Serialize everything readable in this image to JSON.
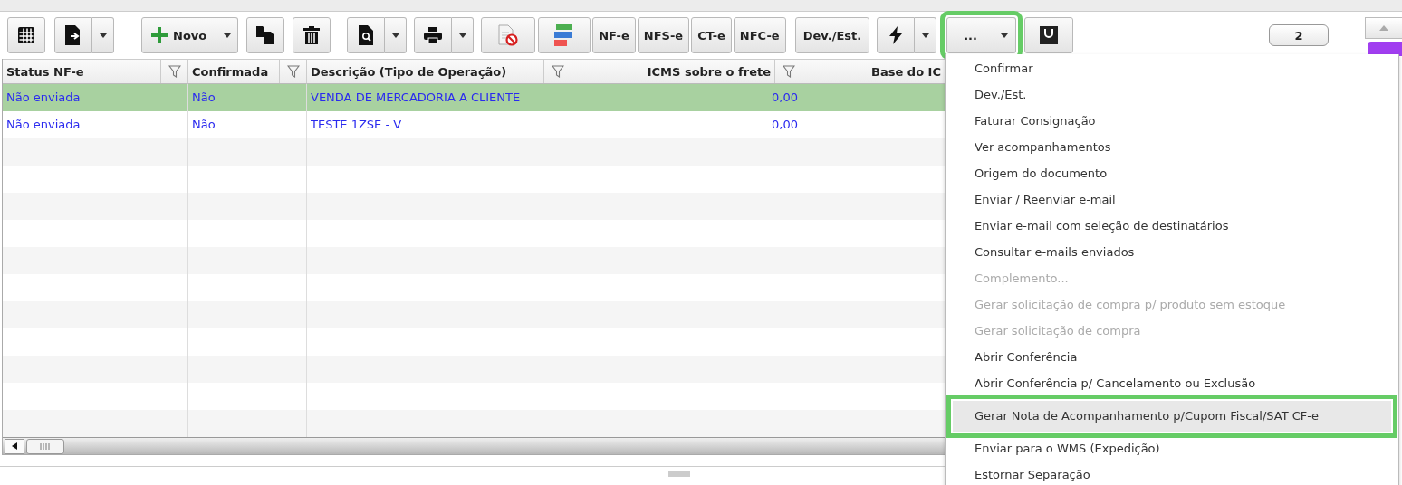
{
  "toolbar": {
    "new_button": {
      "label": "Novo"
    },
    "document_buttons": [
      "NF-e",
      "NFS-e",
      "CT-e",
      "NFC-e"
    ],
    "return_button": {
      "label": "Dev./Est."
    },
    "more_button": {
      "label": "...",
      "highlighted": true
    },
    "counter": "2"
  },
  "table": {
    "columns": [
      {
        "label": "Status NF-e",
        "filter": true
      },
      {
        "label": "Confirmada",
        "filter": true
      },
      {
        "label": "Descrição (Tipo de Operação)",
        "filter": true
      },
      {
        "label": "ICMS sobre o frete",
        "filter": true
      },
      {
        "label": "Base do IC",
        "filter": false
      }
    ],
    "rows": [
      {
        "selected": true,
        "cells": [
          "Não enviada",
          "Não",
          "VENDA DE MERCADORIA A CLIENTE",
          "0,00"
        ]
      },
      {
        "selected": false,
        "cells": [
          "Não enviada",
          "Não",
          "TESTE 1ZSE - V",
          "0,00"
        ]
      }
    ]
  },
  "menu": {
    "items": [
      {
        "label": "Confirmar",
        "disabled": false,
        "hovered": false
      },
      {
        "label": "Dev./Est.",
        "disabled": false,
        "hovered": false
      },
      {
        "label": "Faturar Consignação",
        "disabled": false,
        "hovered": false
      },
      {
        "label": "Ver acompanhamentos",
        "disabled": false,
        "hovered": false
      },
      {
        "label": "Origem do documento",
        "disabled": false,
        "hovered": false
      },
      {
        "label": "Enviar / Reenviar e-mail",
        "disabled": false,
        "hovered": false
      },
      {
        "label": "Enviar e-mail com seleção de destinatários",
        "disabled": false,
        "hovered": false
      },
      {
        "label": "Consultar e-mails enviados",
        "disabled": false,
        "hovered": false
      },
      {
        "label": "Complemento...",
        "disabled": true,
        "hovered": false
      },
      {
        "label": "Gerar solicitação de compra p/ produto sem estoque",
        "disabled": true,
        "hovered": false
      },
      {
        "label": "Gerar solicitação de compra",
        "disabled": true,
        "hovered": false
      },
      {
        "label": "Abrir Conferência",
        "disabled": false,
        "hovered": false
      },
      {
        "label": "Abrir Conferência p/ Cancelamento ou Exclusão",
        "disabled": false,
        "hovered": false
      },
      {
        "label": "Gerar Nota de Acompanhamento p/Cupom Fiscal/SAT CF-e",
        "disabled": false,
        "hovered": true
      },
      {
        "label": "Enviar para o WMS (Expedição)",
        "disabled": false,
        "hovered": false
      },
      {
        "label": "Estornar Separação",
        "disabled": false,
        "hovered": false
      }
    ]
  }
}
